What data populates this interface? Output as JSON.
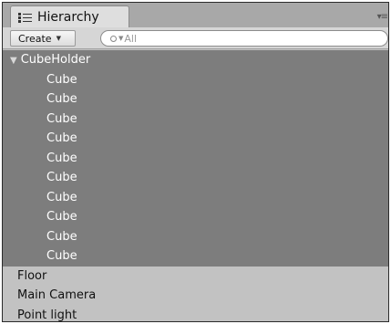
{
  "window": {
    "tab_label": "Hierarchy",
    "tab_menu": "▾≡"
  },
  "toolbar": {
    "create_label": "Create",
    "search_placeholder": "All"
  },
  "tree": {
    "root": {
      "label": "CubeHolder",
      "expanded": true,
      "children": [
        "Cube",
        "Cube",
        "Cube",
        "Cube",
        "Cube",
        "Cube",
        "Cube",
        "Cube",
        "Cube",
        "Cube"
      ]
    },
    "top_level": [
      "Floor",
      "Main Camera",
      "Point light"
    ]
  },
  "colors": {
    "selection": "#7d7d7d",
    "panel": "#c2c2c2",
    "tabbar": "#a8a8a8"
  }
}
